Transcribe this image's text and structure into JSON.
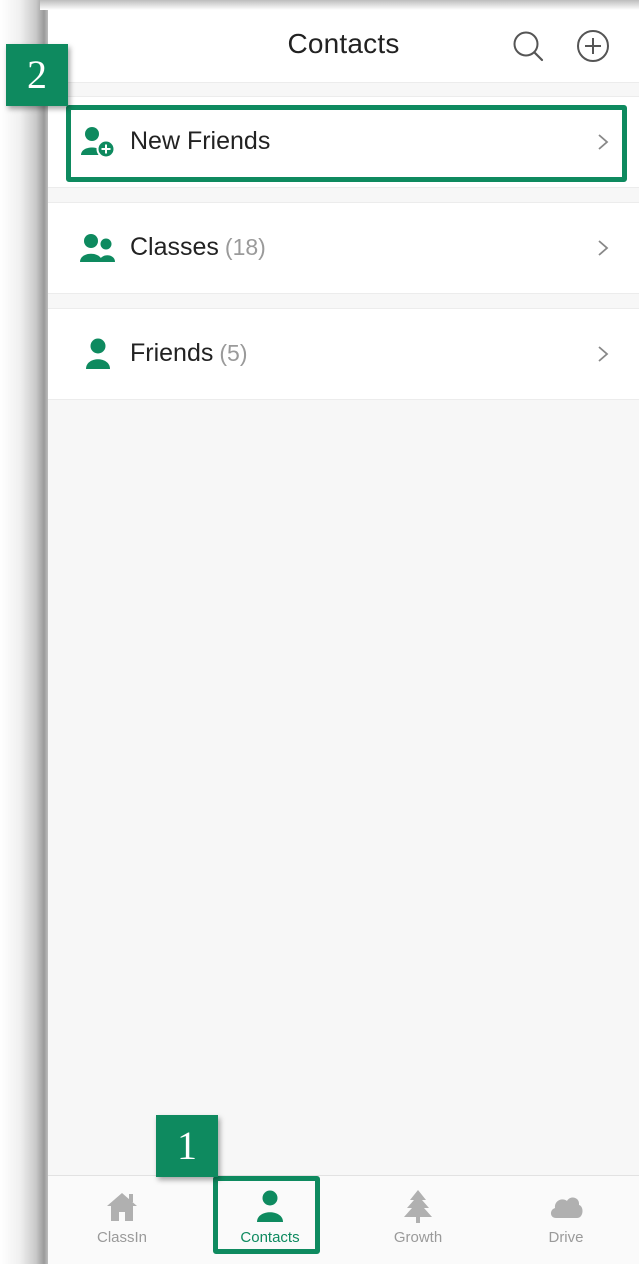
{
  "header": {
    "title": "Contacts"
  },
  "icons": {
    "search": "search-icon",
    "add": "add-circle-icon"
  },
  "rows": [
    {
      "label": "New Friends",
      "count": "",
      "icon": "add-person-icon"
    },
    {
      "label": "Classes",
      "count": "(18)",
      "icon": "group-icon"
    },
    {
      "label": "Friends",
      "count": "(5)",
      "icon": "person-icon"
    }
  ],
  "tabs": [
    {
      "label": "ClassIn",
      "icon": "home-icon",
      "active": false
    },
    {
      "label": "Contacts",
      "icon": "person-icon",
      "active": true
    },
    {
      "label": "Growth",
      "icon": "tree-icon",
      "active": false
    },
    {
      "label": "Drive",
      "icon": "cloud-icon",
      "active": false
    }
  ],
  "annotations": {
    "badge_1": "1",
    "badge_2": "2"
  },
  "colors": {
    "accent": "#0e8a5f",
    "inactive": "#b0b0b0",
    "text": "#222222",
    "muted": "#9a9a9a"
  }
}
